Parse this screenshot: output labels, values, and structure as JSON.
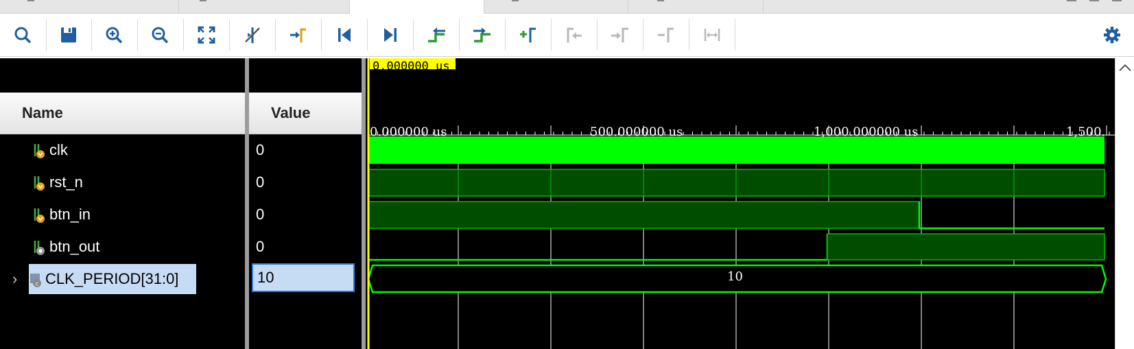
{
  "tabs": [
    {
      "label": "",
      "active": false
    },
    {
      "label": "",
      "active": false
    },
    {
      "label": "",
      "active": true
    },
    {
      "label": "",
      "active": false
    },
    {
      "label": "",
      "active": false
    },
    {
      "label": "",
      "active": false
    }
  ],
  "toolbar": {
    "buttons": [
      {
        "icon": "search-icon",
        "enabled": true
      },
      {
        "icon": "save-icon",
        "enabled": true
      },
      {
        "icon": "zoom-in-icon",
        "enabled": true
      },
      {
        "icon": "zoom-out-icon",
        "enabled": true
      },
      {
        "icon": "zoom-fit-icon",
        "enabled": true
      },
      {
        "icon": "zoom-to-cursor-icon",
        "enabled": true
      },
      {
        "icon": "go-to-time-zero-icon",
        "enabled": true
      },
      {
        "icon": "go-to-start-icon",
        "enabled": true
      },
      {
        "icon": "go-to-end-icon",
        "enabled": true
      },
      {
        "icon": "previous-transition-icon",
        "enabled": true
      },
      {
        "icon": "next-transition-icon",
        "enabled": true
      },
      {
        "icon": "add-marker-icon",
        "enabled": true
      },
      {
        "icon": "previous-marker-icon",
        "enabled": false
      },
      {
        "icon": "next-marker-icon",
        "enabled": false
      },
      {
        "icon": "delete-marker-icon",
        "enabled": false
      },
      {
        "icon": "swap-cursors-icon",
        "enabled": false
      }
    ],
    "settings_icon": "gear-icon"
  },
  "panel": {
    "name_header": "Name",
    "value_header": "Value"
  },
  "signals": [
    {
      "name": "clk",
      "value": "0",
      "kind": "input",
      "expandable": false,
      "selected": false
    },
    {
      "name": "rst_n",
      "value": "0",
      "kind": "input",
      "expandable": false,
      "selected": false
    },
    {
      "name": "btn_in",
      "value": "0",
      "kind": "input",
      "expandable": false,
      "selected": false
    },
    {
      "name": "btn_out",
      "value": "0",
      "kind": "output",
      "expandable": false,
      "selected": false
    },
    {
      "name": "CLK_PERIOD[31:0]",
      "value": "10",
      "kind": "parameter",
      "expandable": true,
      "selected": true
    }
  ],
  "waveform": {
    "cursor_label": "0.000000 us",
    "ruler_labels": [
      "0.000000 us",
      "500.000000 us",
      "1,000.000000 us",
      "1,500."
    ],
    "bus_value": "10",
    "colors": {
      "signal": "#00ff00",
      "dim": "#004d00",
      "cursor": "#ffff00",
      "grid": "#ffffff"
    }
  }
}
